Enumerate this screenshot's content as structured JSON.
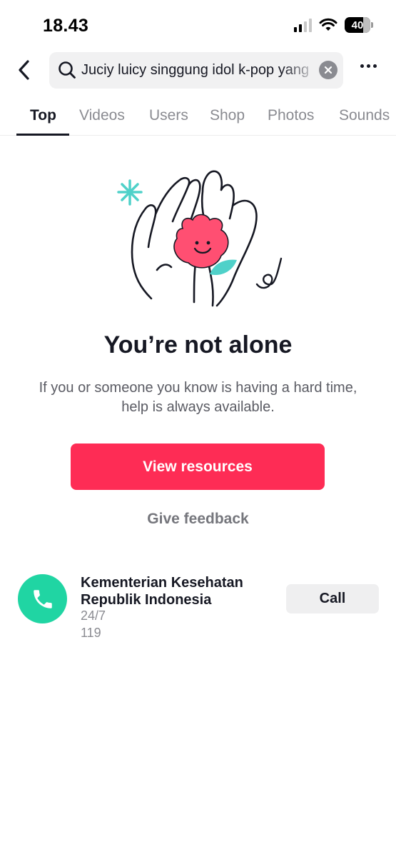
{
  "status_bar": {
    "time": "18.43",
    "battery": "40",
    "icons": [
      "cellular-signal-icon",
      "wifi-icon",
      "battery-icon"
    ]
  },
  "search": {
    "query": "Juciy luicy singgung idol k-pop yang",
    "icons": [
      "back-arrow-icon",
      "search-icon",
      "clear-icon",
      "more-icon"
    ]
  },
  "tabs": [
    {
      "label": "Top",
      "active": true
    },
    {
      "label": "Videos",
      "active": false
    },
    {
      "label": "Users",
      "active": false
    },
    {
      "label": "Shop",
      "active": false
    },
    {
      "label": "Photos",
      "active": false
    },
    {
      "label": "Sounds",
      "active": false
    }
  ],
  "support": {
    "title": "You’re not alone",
    "description": "If you or someone you know is having a hard time, help is always available.",
    "primary_button": "View resources",
    "feedback_link": "Give feedback"
  },
  "resource": {
    "name": "Kementerian Kesehatan Republik Indonesia",
    "hours": "24/7",
    "number": "119",
    "action_label": "Call",
    "icon": "phone-icon"
  },
  "colors": {
    "accent": "#fe2c55",
    "phone_badge": "#20d5a3",
    "text_primary": "#161823",
    "text_secondary": "#8a8b91"
  }
}
